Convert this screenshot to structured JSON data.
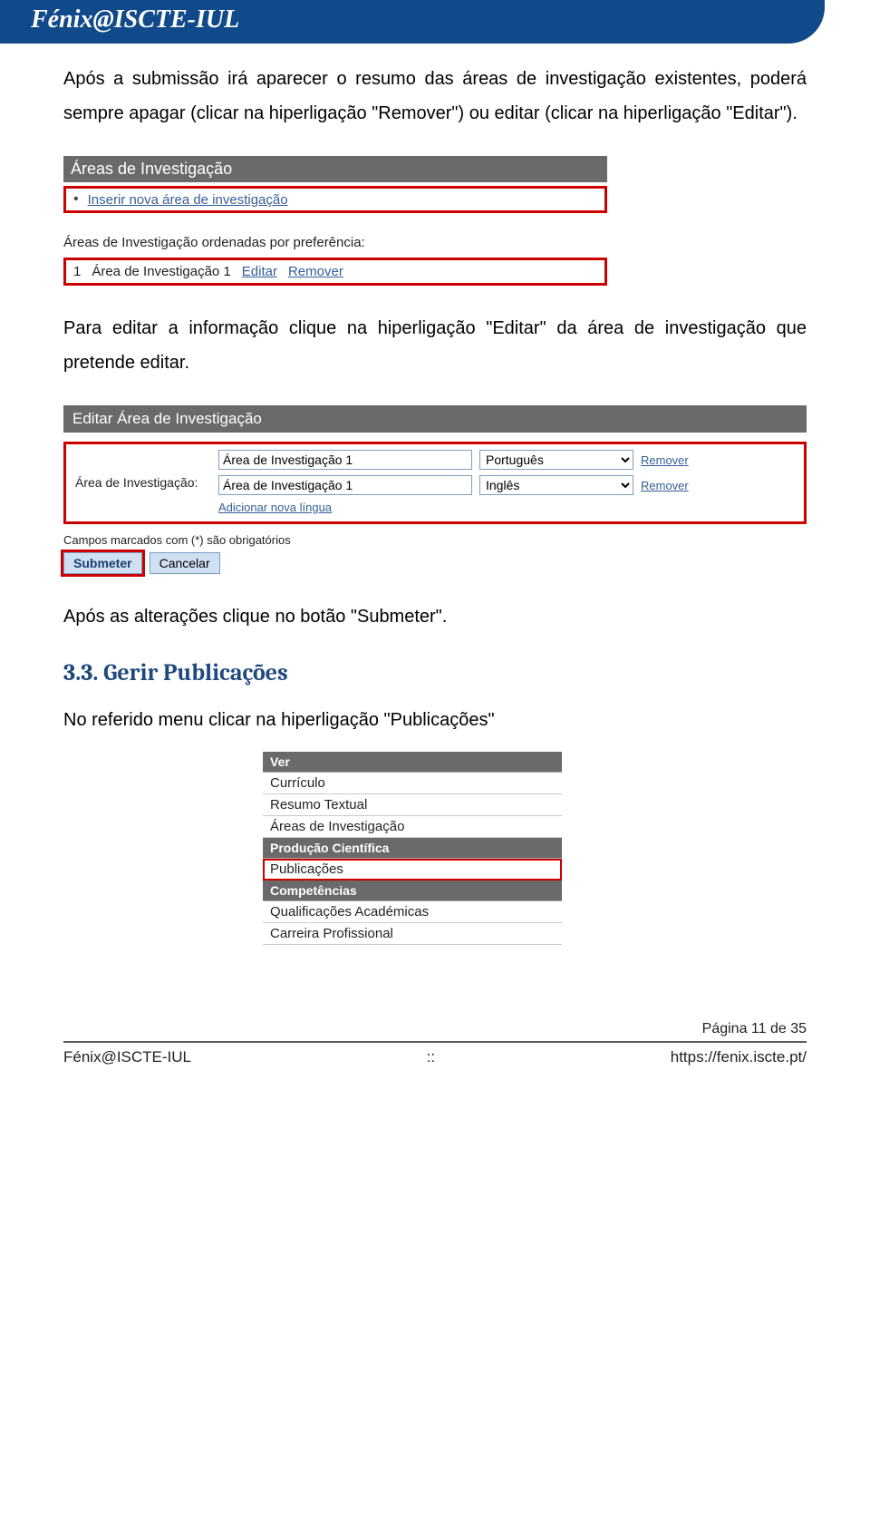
{
  "header": {
    "brand": "Fénix@ISCTE-IUL"
  },
  "paragraphs": {
    "p1": "Após a submissão irá aparecer o resumo das áreas de investigação existentes, poderá sempre apagar (clicar na hiperligação \"Remover\") ou editar (clicar na hiperligação \"Editar\").",
    "p2": "Para editar a informação clique na hiperligação \"Editar\" da área de investigação que pretende editar.",
    "p3": "Após as alterações clique no botão \"Submeter\".",
    "p4": "No referido menu clicar na hiperligação \"Publicações\""
  },
  "fig1": {
    "title": "Áreas de Investigação",
    "insert_link": "Inserir nova área de investigação",
    "subtitle": "Áreas de Investigação ordenadas por preferência:",
    "row": {
      "num": "1",
      "name": "Área de Investigação 1",
      "edit": "Editar",
      "remove": "Remover"
    }
  },
  "fig2": {
    "title": "Editar Área de Investigação",
    "field_label": "Área de Investigação:",
    "val1": "Área de Investigação 1",
    "lang1": "Português",
    "val2": "Área de Investigação 1",
    "lang2": "Inglês",
    "remove": "Remover",
    "add_lang": "Adicionar nova língua",
    "note": "Campos marcados com (*) são obrigatórios",
    "btn_submit": "Submeter",
    "btn_cancel": "Cancelar"
  },
  "section33": {
    "heading": "3.3. Gerir Publicações"
  },
  "fig3": {
    "ver": {
      "head": "Ver",
      "items": [
        "Currículo",
        "Resumo Textual",
        "Áreas de Investigação"
      ]
    },
    "prod": {
      "head": "Produção Científica",
      "item": "Publicações"
    },
    "comp": {
      "head": "Competências",
      "items": [
        "Qualificações Académicas",
        "Carreira Profissional"
      ]
    }
  },
  "footer": {
    "page": "Página 11 de 35",
    "left": "Fénix@ISCTE-IUL",
    "mid": "::",
    "right": "https://fenix.iscte.pt/"
  }
}
